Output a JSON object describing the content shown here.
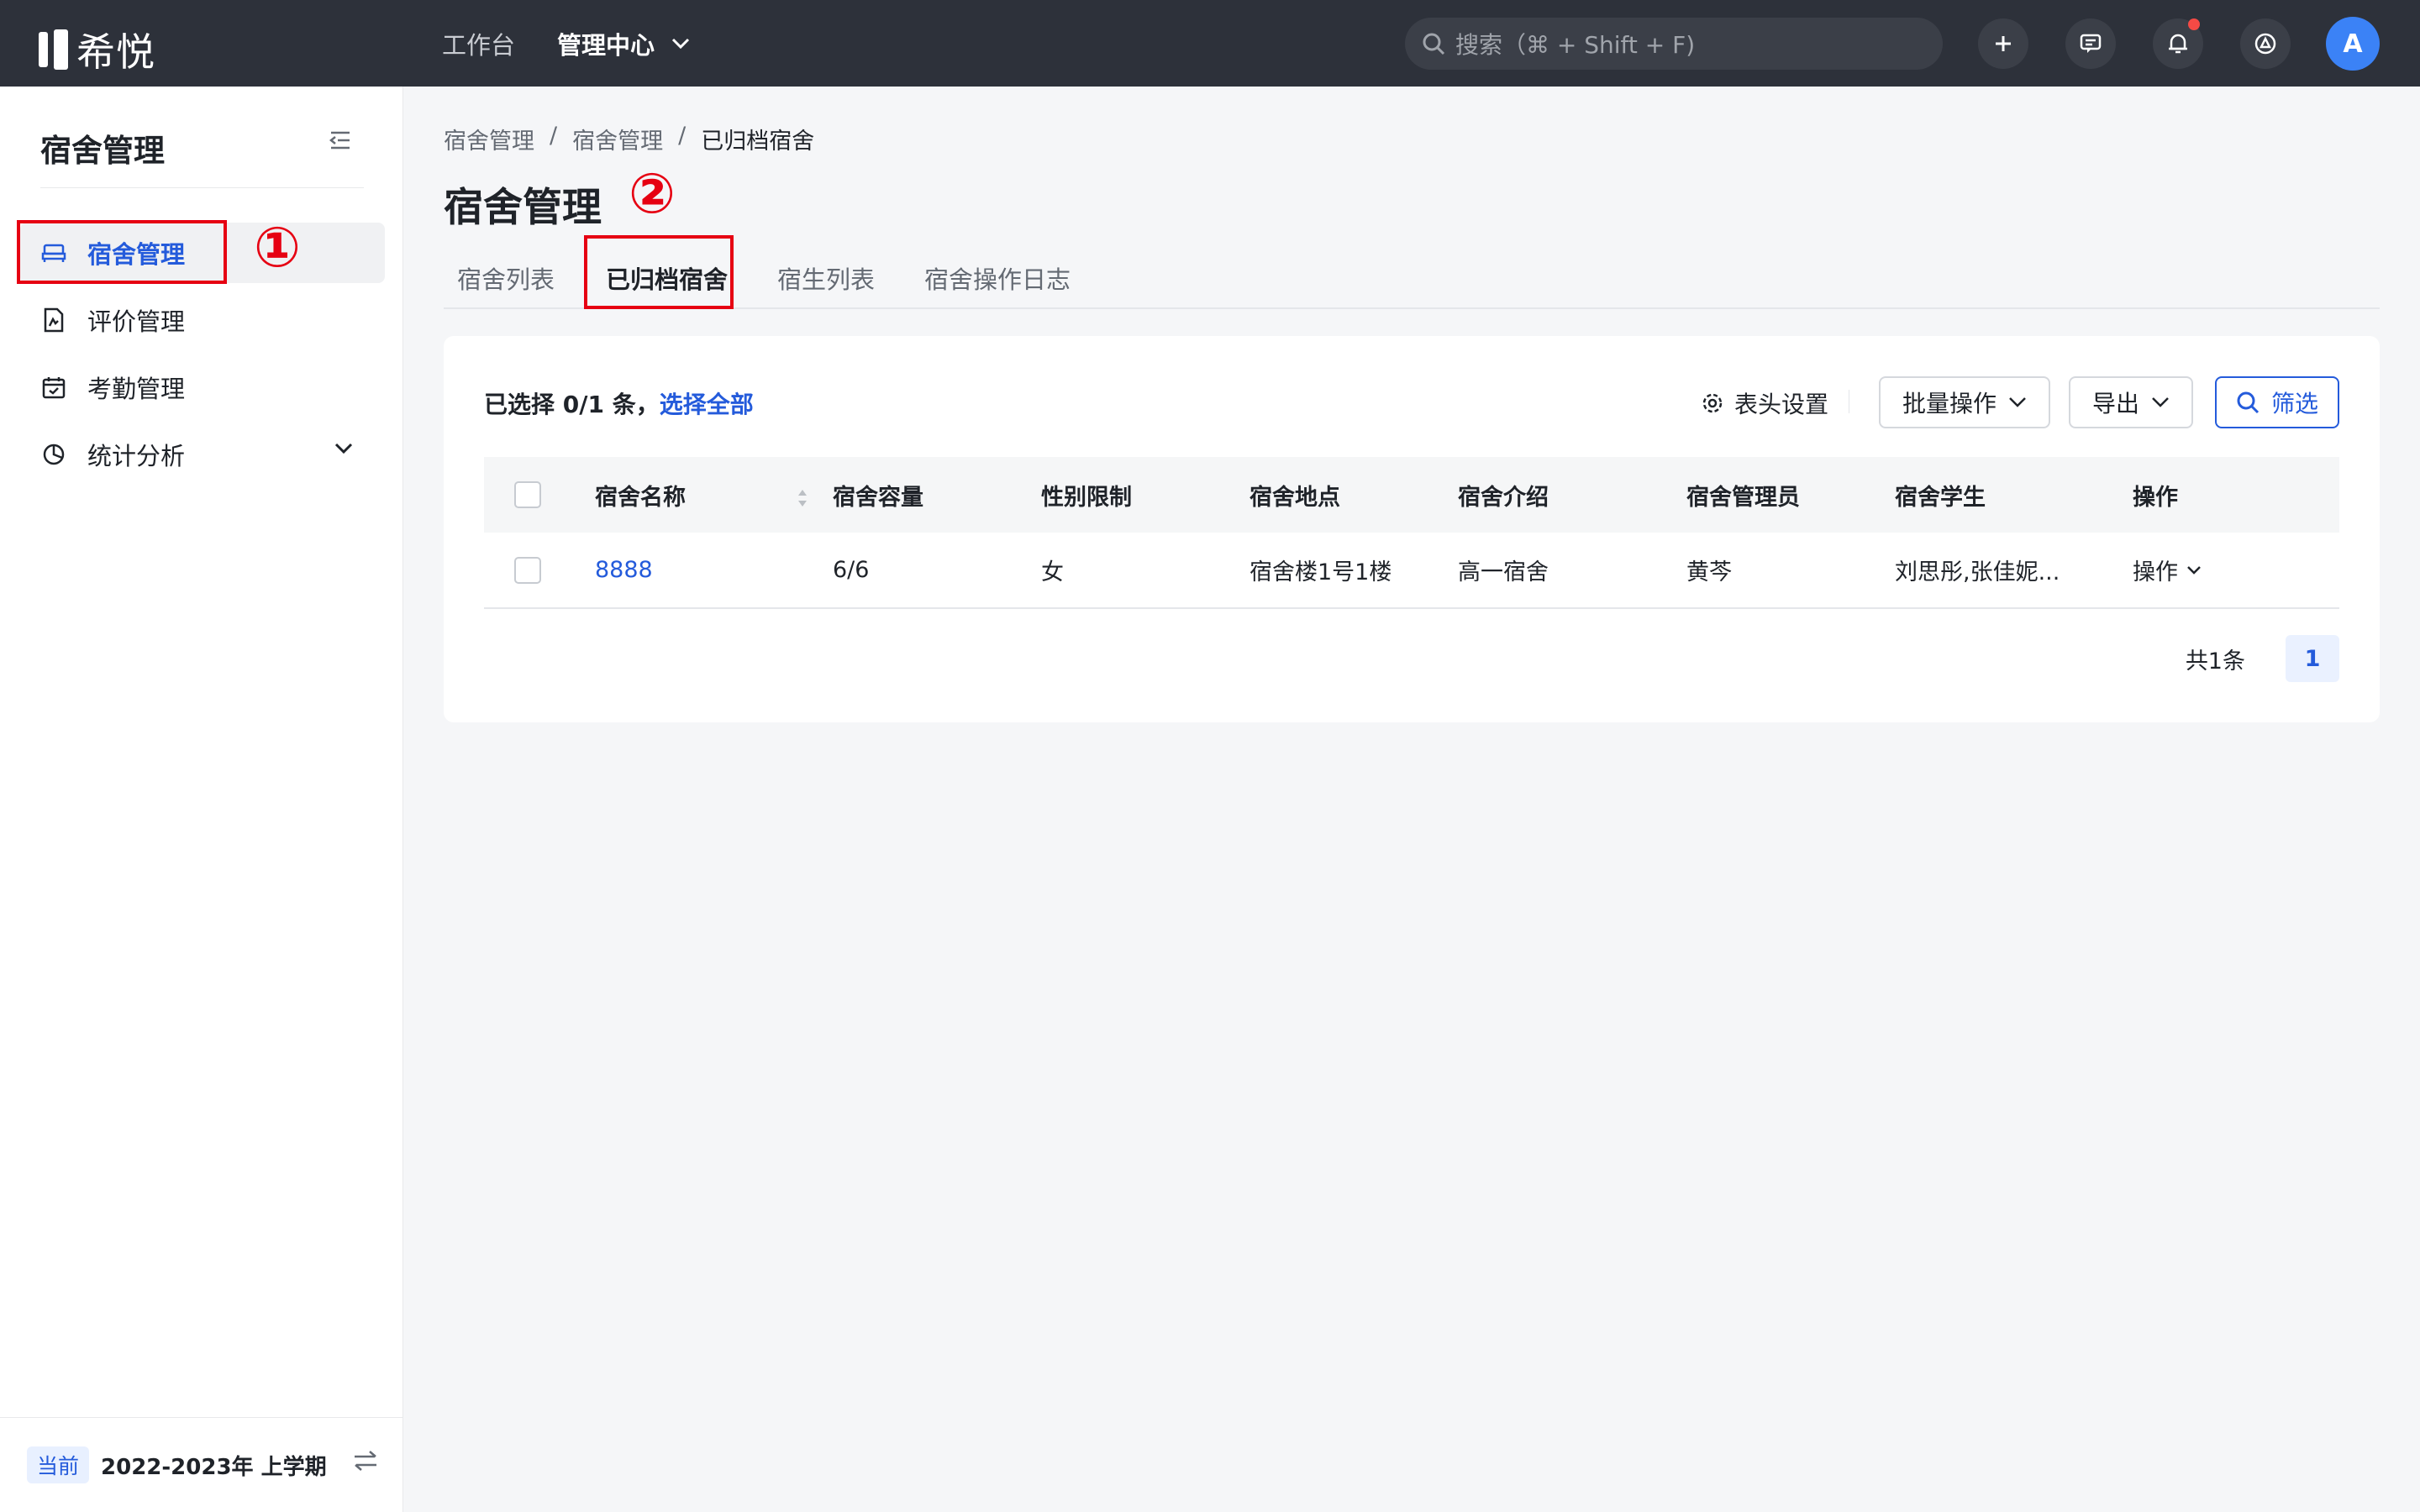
{
  "app": {
    "logo_text": "希悦"
  },
  "topnav": {
    "items": [
      {
        "label": "工作台"
      },
      {
        "label": "管理中心"
      }
    ],
    "search_placeholder": "搜索（⌘ + Shift + F)",
    "avatar_initial": "A"
  },
  "sidebar": {
    "title": "宿舍管理",
    "items": [
      {
        "label": "宿舍管理",
        "icon": "bed-icon"
      },
      {
        "label": "评价管理",
        "icon": "evaluation-doc-icon"
      },
      {
        "label": "考勤管理",
        "icon": "calendar-icon"
      },
      {
        "label": "统计分析",
        "icon": "pie-chart-icon"
      }
    ],
    "footer": {
      "tag": "当前",
      "term": "2022-2023年 上学期"
    }
  },
  "breadcrumb": [
    "宿舍管理",
    "宿舍管理",
    "已归档宿舍"
  ],
  "breadcrumb_sep": "/",
  "page_title": "宿舍管理",
  "tabs": [
    {
      "label": "宿舍列表"
    },
    {
      "label": "已归档宿舍"
    },
    {
      "label": "宿生列表"
    },
    {
      "label": "宿舍操作日志"
    }
  ],
  "toolbar": {
    "selected_text": "已选择 0/1 条，",
    "select_all": "选择全部",
    "header_settings": "表头设置",
    "batch": "批量操作",
    "export": "导出",
    "filter": "筛选"
  },
  "table": {
    "columns": [
      "宿舍名称",
      "宿舍容量",
      "性别限制",
      "宿舍地点",
      "宿舍介绍",
      "宿舍管理员",
      "宿舍学生",
      "操作"
    ],
    "rows": [
      {
        "name": "8888",
        "capacity": "6/6",
        "gender": "女",
        "location": "宿舍楼1号1楼",
        "intro": "高一宿舍",
        "manager": "黄芩",
        "students": "刘思彤,张佳妮...",
        "action": "操作"
      }
    ]
  },
  "pager": {
    "total": "共1条",
    "current": "1"
  },
  "annotations": {
    "one": "①",
    "two": "②"
  },
  "colors": {
    "accent": "#245bdb",
    "topbar": "#2d313a",
    "annotation": "#e60012"
  }
}
